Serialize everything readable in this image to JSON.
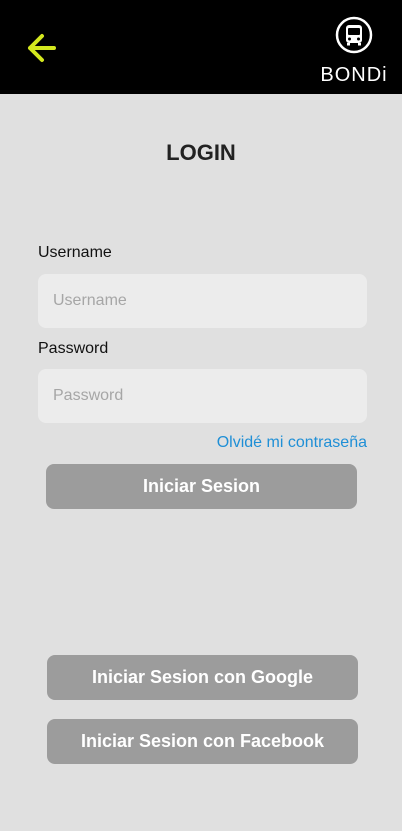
{
  "header": {
    "back_icon": "arrow-left-icon",
    "brand_icon": "bus-icon",
    "brand_name": "BONDi",
    "accent_color": "#d4e81e"
  },
  "login": {
    "title": "LOGIN",
    "username_label": "Username",
    "username_placeholder": "Username",
    "password_label": "Password",
    "password_placeholder": "Password",
    "forgot_password": "Olvidé mi contraseña",
    "submit_label": "Iniciar Sesion"
  },
  "social": {
    "google_label": "Iniciar Sesion con Google",
    "facebook_label": "Iniciar Sesion con Facebook"
  },
  "colors": {
    "header_bg": "#000000",
    "page_bg": "#e0e0e0",
    "input_bg": "#ececec",
    "button_bg": "#9c9c9c",
    "link": "#1f8fd6"
  }
}
